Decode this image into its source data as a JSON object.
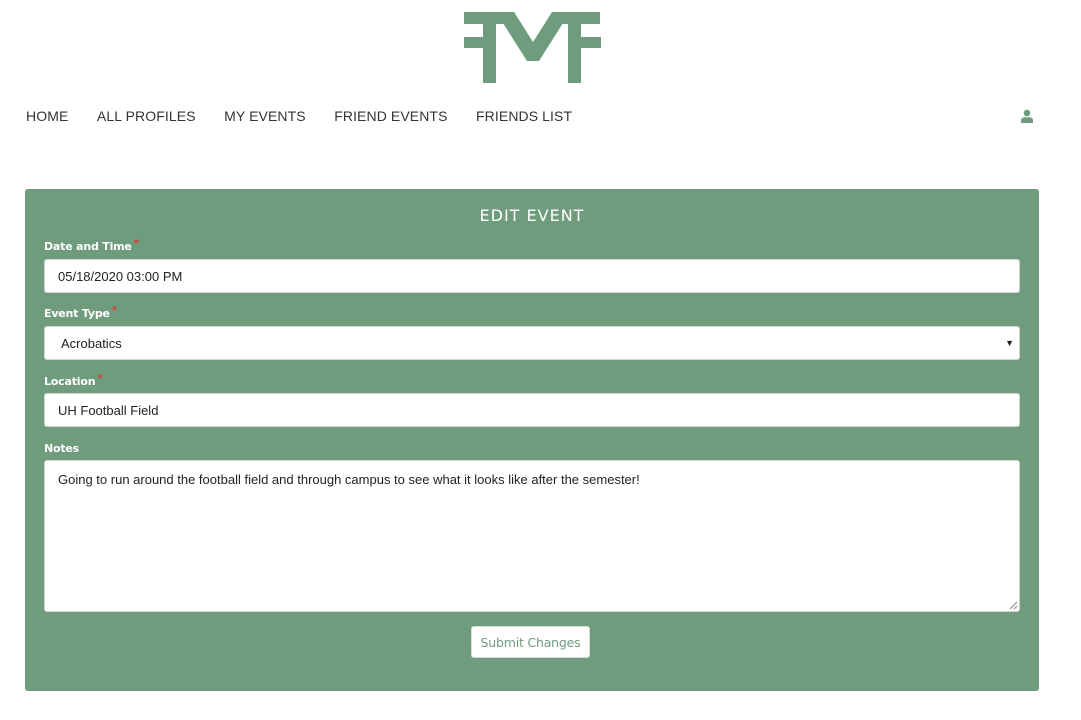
{
  "brand": {
    "logo_text": "FMF",
    "logo_color": "#6f9c7d"
  },
  "nav": {
    "items": [
      {
        "label": "HOME"
      },
      {
        "label": "ALL PROFILES"
      },
      {
        "label": "MY EVENTS"
      },
      {
        "label": "FRIEND EVENTS"
      },
      {
        "label": "FRIENDS LIST"
      }
    ],
    "user_icon": "user-icon"
  },
  "form": {
    "title": "EDIT EVENT",
    "accent_color": "#6f9c7d",
    "required_marker": "*",
    "date_label": "Date and Time",
    "date_value": "05/18/2020 03:00 PM",
    "event_type_label": "Event Type",
    "event_type_value": "Acrobatics",
    "location_label": "Location",
    "location_value": "UH Football Field",
    "notes_label": "Notes",
    "notes_value": "Going to run around the football field and through campus to see what it looks like after the semester!",
    "submit_label": "Submit Changes"
  }
}
